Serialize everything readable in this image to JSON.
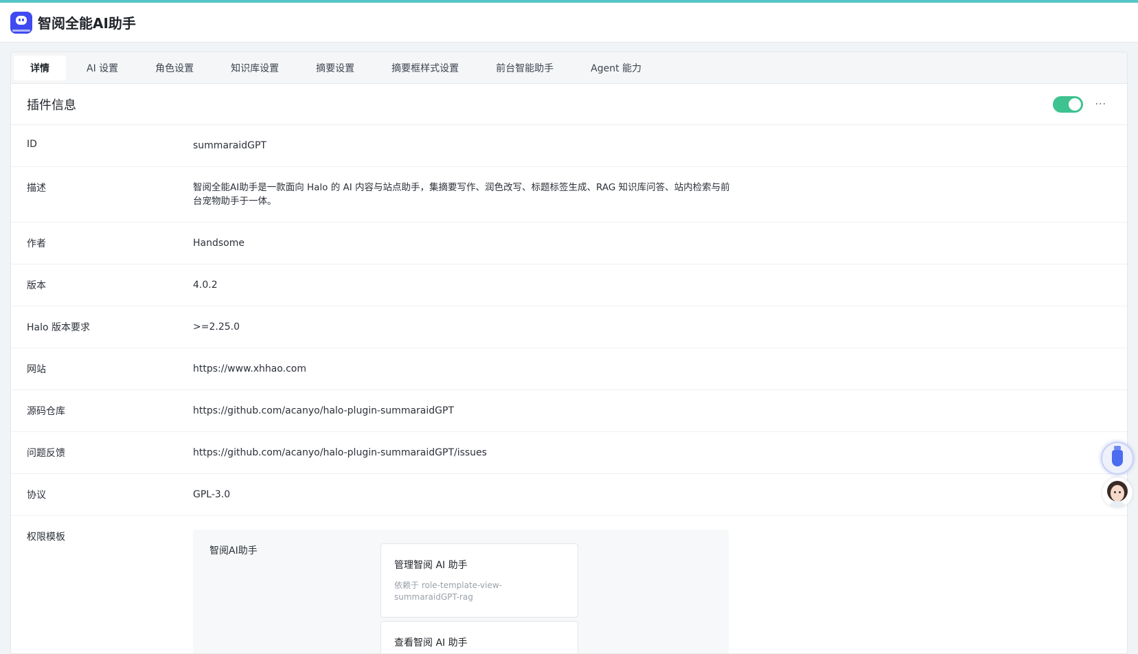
{
  "app": {
    "title": "智阅全能AI助手",
    "accent": "#56c6c6",
    "logo_color": "#3f4bf0"
  },
  "tabs": [
    {
      "label": "详情",
      "active": true
    },
    {
      "label": "AI 设置"
    },
    {
      "label": "角色设置"
    },
    {
      "label": "知识库设置"
    },
    {
      "label": "摘要设置"
    },
    {
      "label": "摘要框样式设置"
    },
    {
      "label": "前台智能助手"
    },
    {
      "label": "Agent 能力"
    }
  ],
  "section": {
    "title": "插件信息",
    "enabled": true,
    "toggle_color": "#3ec28f",
    "more_label": "···"
  },
  "info": {
    "id": {
      "label": "ID",
      "value": "summaraidGPT"
    },
    "description": {
      "label": "描述",
      "value": "智阅全能AI助手是一款面向 Halo 的 AI 内容与站点助手，集摘要写作、润色改写、标题标签生成、RAG 知识库问答、站内检索与前台宠物助手于一体。"
    },
    "author": {
      "label": "作者",
      "value": "Handsome"
    },
    "version": {
      "label": "版本",
      "value": "4.0.2"
    },
    "halo_requirement": {
      "label": "Halo 版本要求",
      "value": ">=2.25.0"
    },
    "website": {
      "label": "网站",
      "value": "https://www.xhhao.com"
    },
    "repo": {
      "label": "源码仓库",
      "value": "https://github.com/acanyo/halo-plugin-summaraidGPT"
    },
    "issues": {
      "label": "问题反馈",
      "value": "https://github.com/acanyo/halo-plugin-summaraidGPT/issues"
    },
    "license": {
      "label": "协议",
      "value": "GPL-3.0"
    },
    "permissions": {
      "label": "权限模板",
      "group": "智阅AI助手",
      "items": [
        {
          "title": "管理智阅 AI 助手",
          "dependency": "依赖于 role-template-view-summaraidGPT-rag"
        },
        {
          "title": "查看智阅 AI 助手"
        }
      ]
    }
  },
  "floaters": {
    "assistant_icon": "glove-icon",
    "avatar_icon": "avatar-icon"
  }
}
